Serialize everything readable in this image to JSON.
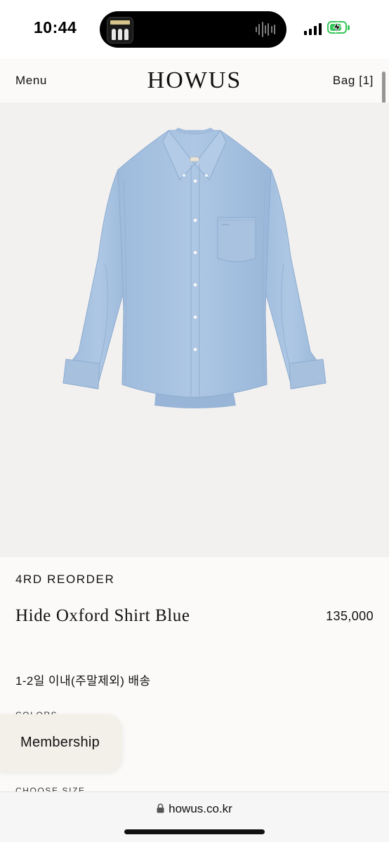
{
  "status_bar": {
    "time": "10:44",
    "battery_level": 0.8,
    "signal_bars": 4,
    "icons": [
      "now-playing-icon",
      "audio-wave-icon",
      "signal-icon",
      "battery-charging-icon"
    ]
  },
  "header": {
    "menu_label": "Menu",
    "brand": "HOWUS",
    "bag_label": "Bag [1]"
  },
  "product": {
    "image_subject": "light blue oxford button-down shirt",
    "collection": "4RD REORDER",
    "title": "Hide Oxford Shirt Blue",
    "price": "135,000",
    "delivery": "1-2일 이내(주말제외) 배송",
    "colors_label": "COLORS",
    "size_label": "CHOOSE SIZE"
  },
  "membership": {
    "label": "Membership"
  },
  "browser": {
    "url": "howus.co.kr"
  },
  "colors": {
    "background": "#fbfaf8",
    "image_background": "#f2f1f0",
    "shirt": "#a9c4e2",
    "membership_bg": "#f3f0e9",
    "battery": "#35c759"
  }
}
